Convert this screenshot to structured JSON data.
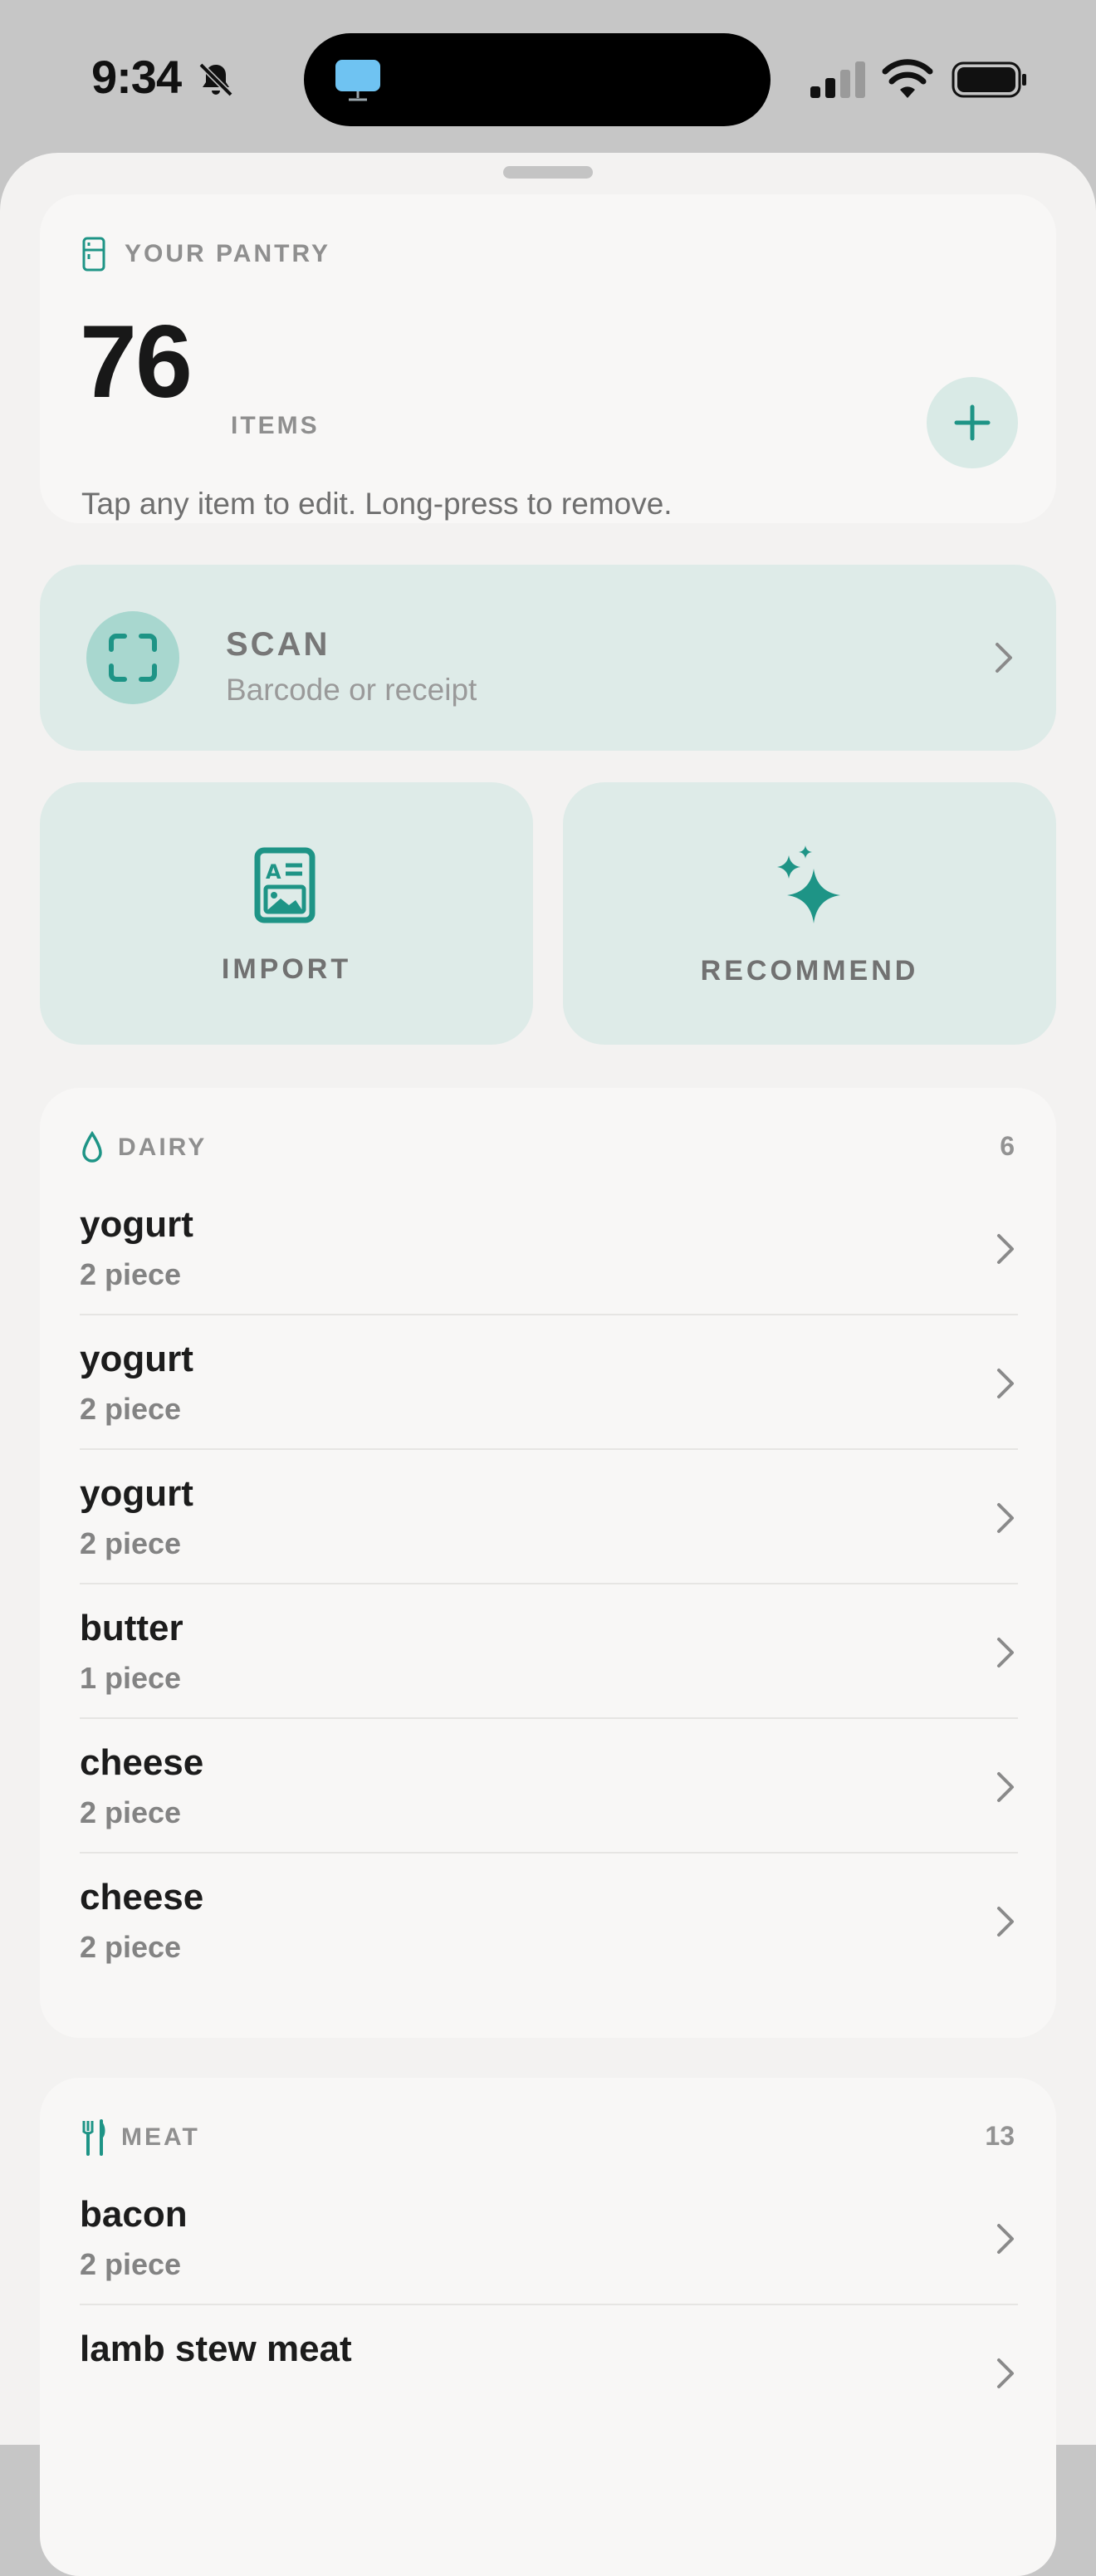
{
  "status_bar": {
    "time": "9:34",
    "icons": [
      "bell-slash-icon",
      "tv-icon",
      "cellular-signal-icon",
      "wifi-icon",
      "battery-icon"
    ]
  },
  "pantry": {
    "caption": "YOUR PANTRY",
    "count": "76",
    "count_unit": "ITEMS",
    "hint": "Tap any item to edit. Long-press to remove.",
    "icon": "fridge-icon",
    "add_icon": "plus-icon"
  },
  "scan": {
    "title": "SCAN",
    "subtitle": "Barcode or receipt",
    "icon": "scan-frame-icon"
  },
  "actions": {
    "import_label": "IMPORT",
    "import_icon": "document-image-icon",
    "recommend_label": "RECOMMEND",
    "recommend_icon": "sparkles-icon"
  },
  "sections": [
    {
      "title": "DAIRY",
      "count": "6",
      "icon": "drop-icon",
      "items": [
        {
          "name": "yogurt",
          "qty": "2 piece"
        },
        {
          "name": "yogurt",
          "qty": "2 piece"
        },
        {
          "name": "yogurt",
          "qty": "2 piece"
        },
        {
          "name": "butter",
          "qty": "1 piece"
        },
        {
          "name": "cheese",
          "qty": "2 piece"
        },
        {
          "name": "cheese",
          "qty": "2 piece"
        }
      ]
    },
    {
      "title": "MEAT",
      "count": "13",
      "icon": "fork-knife-icon",
      "items": [
        {
          "name": "bacon",
          "qty": "2 piece"
        },
        {
          "name": "lamb stew meat",
          "qty": ""
        }
      ]
    }
  ],
  "colors": {
    "accent": "#1e9486",
    "accent_light": "#a8d7cf",
    "tile_bg": "#deebe8",
    "card_bg": "#f8f7f6",
    "sheet_bg": "#f3f2f1"
  }
}
